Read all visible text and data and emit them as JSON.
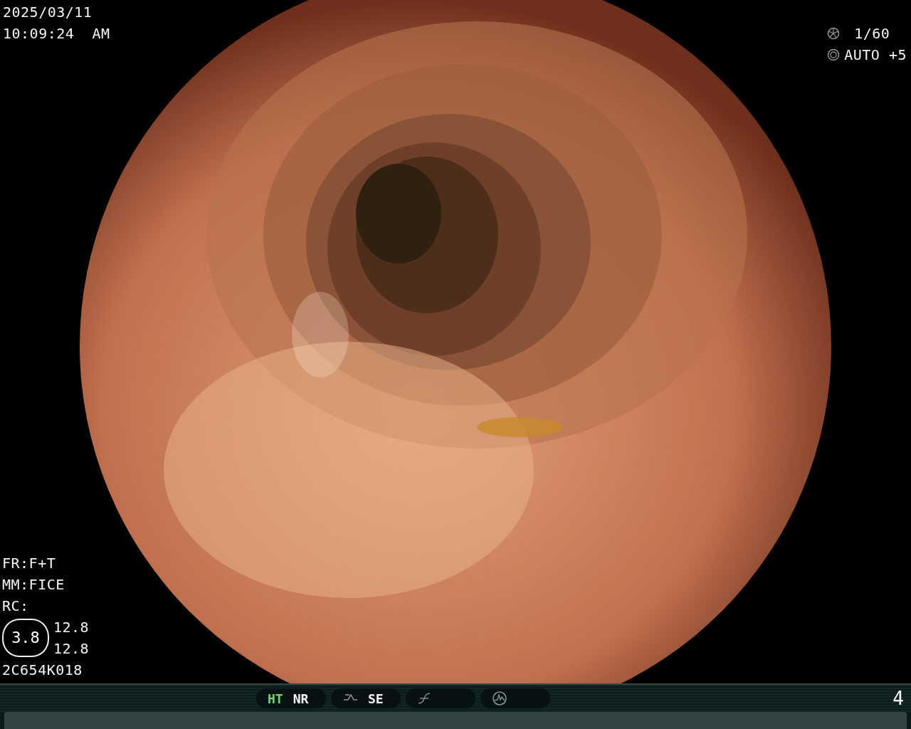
{
  "overlay_top_left": {
    "date": "2025/03/11",
    "time": "10:09:24  AM"
  },
  "overlay_top_right": {
    "shutter": "1/60",
    "iris": "AUTO +5"
  },
  "overlay_bottom_left": {
    "lines": [
      "FR:F+T",
      "MM:FICE",
      "RC:"
    ],
    "gauge": "3.8",
    "readings": [
      "12.8",
      "12.8"
    ],
    "serial": "2C654K018"
  },
  "status_bar": {
    "groups": [
      {
        "kind": "text",
        "items": [
          {
            "label": "HT",
            "on": true
          },
          {
            "label": "NR",
            "on": false
          }
        ]
      },
      {
        "kind": "enhance",
        "label": "SE"
      },
      {
        "kind": "curve"
      },
      {
        "kind": "wave"
      }
    ],
    "number": "4"
  }
}
